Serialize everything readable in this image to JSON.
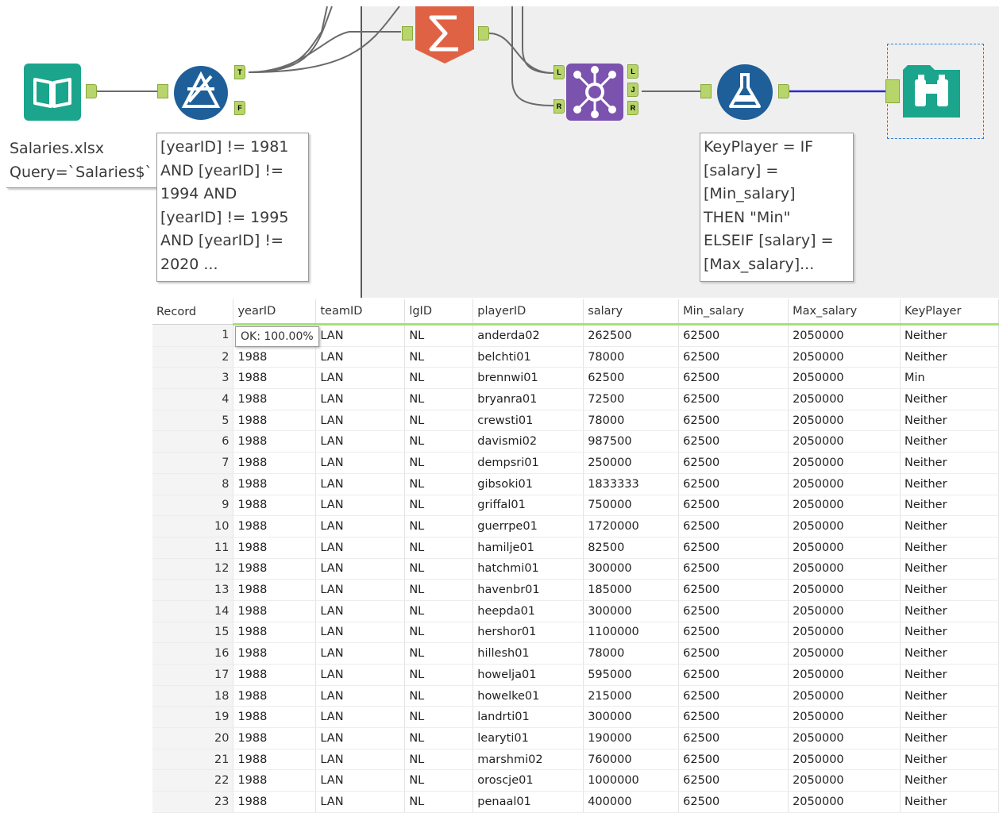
{
  "workflow": {
    "input_annotation": "Salaries.xlsx\nQuery=`Salaries$`",
    "filter_annotation": "[yearID] != 1981\nAND [yearID] !=\n1994 AND\n[yearID] != 1995\nAND [yearID] !=\n2020 ...",
    "formula_annotation": "KeyPlayer = IF\n[salary] =\n[Min_salary]\nTHEN \"Min\"\nELSEIF [salary] =\n[Max_salary]...",
    "filter_true_anchor": "T",
    "filter_false_anchor": "F",
    "join_left_in": "L",
    "join_right_in": "R",
    "join_out_left": "L",
    "join_out_join": "J",
    "join_out_right": "R",
    "icons": [
      "input-book-icon",
      "filter-icon",
      "summarize-sigma-icon",
      "join-icon",
      "formula-flask-icon",
      "browse-binoculars-icon"
    ],
    "colors": {
      "input": "#1aa58c",
      "filter": "#1f5f99",
      "summarize": "#e06245",
      "join": "#7b52ae",
      "formula": "#1f5f99",
      "browse": "#1aa58c",
      "anchor": "#b7d56a",
      "selection": "#2f7fd8"
    }
  },
  "tooltip": "OK: 100.00%",
  "results": {
    "columns": [
      "Record",
      "yearID",
      "teamID",
      "lgID",
      "playerID",
      "salary",
      "Min_salary",
      "Max_salary",
      "KeyPlayer"
    ],
    "rows": [
      [
        "1",
        "1988",
        "LAN",
        "NL",
        "anderda02",
        "262500",
        "62500",
        "2050000",
        "Neither"
      ],
      [
        "2",
        "1988",
        "LAN",
        "NL",
        "belchti01",
        "78000",
        "62500",
        "2050000",
        "Neither"
      ],
      [
        "3",
        "1988",
        "LAN",
        "NL",
        "brennwi01",
        "62500",
        "62500",
        "2050000",
        "Min"
      ],
      [
        "4",
        "1988",
        "LAN",
        "NL",
        "bryanra01",
        "72500",
        "62500",
        "2050000",
        "Neither"
      ],
      [
        "5",
        "1988",
        "LAN",
        "NL",
        "crewsti01",
        "78000",
        "62500",
        "2050000",
        "Neither"
      ],
      [
        "6",
        "1988",
        "LAN",
        "NL",
        "davismi02",
        "987500",
        "62500",
        "2050000",
        "Neither"
      ],
      [
        "7",
        "1988",
        "LAN",
        "NL",
        "dempsri01",
        "250000",
        "62500",
        "2050000",
        "Neither"
      ],
      [
        "8",
        "1988",
        "LAN",
        "NL",
        "gibsoki01",
        "1833333",
        "62500",
        "2050000",
        "Neither"
      ],
      [
        "9",
        "1988",
        "LAN",
        "NL",
        "griffal01",
        "750000",
        "62500",
        "2050000",
        "Neither"
      ],
      [
        "10",
        "1988",
        "LAN",
        "NL",
        "guerrpe01",
        "1720000",
        "62500",
        "2050000",
        "Neither"
      ],
      [
        "11",
        "1988",
        "LAN",
        "NL",
        "hamilje01",
        "82500",
        "62500",
        "2050000",
        "Neither"
      ],
      [
        "12",
        "1988",
        "LAN",
        "NL",
        "hatchmi01",
        "300000",
        "62500",
        "2050000",
        "Neither"
      ],
      [
        "13",
        "1988",
        "LAN",
        "NL",
        "havenbr01",
        "185000",
        "62500",
        "2050000",
        "Neither"
      ],
      [
        "14",
        "1988",
        "LAN",
        "NL",
        "heepda01",
        "300000",
        "62500",
        "2050000",
        "Neither"
      ],
      [
        "15",
        "1988",
        "LAN",
        "NL",
        "hershor01",
        "1100000",
        "62500",
        "2050000",
        "Neither"
      ],
      [
        "16",
        "1988",
        "LAN",
        "NL",
        "hillesh01",
        "78000",
        "62500",
        "2050000",
        "Neither"
      ],
      [
        "17",
        "1988",
        "LAN",
        "NL",
        "howelja01",
        "595000",
        "62500",
        "2050000",
        "Neither"
      ],
      [
        "18",
        "1988",
        "LAN",
        "NL",
        "howelke01",
        "215000",
        "62500",
        "2050000",
        "Neither"
      ],
      [
        "19",
        "1988",
        "LAN",
        "NL",
        "landrti01",
        "300000",
        "62500",
        "2050000",
        "Neither"
      ],
      [
        "20",
        "1988",
        "LAN",
        "NL",
        "learyti01",
        "190000",
        "62500",
        "2050000",
        "Neither"
      ],
      [
        "21",
        "1988",
        "LAN",
        "NL",
        "marshmi02",
        "760000",
        "62500",
        "2050000",
        "Neither"
      ],
      [
        "22",
        "1988",
        "LAN",
        "NL",
        "oroscje01",
        "1000000",
        "62500",
        "2050000",
        "Neither"
      ],
      [
        "23",
        "1988",
        "LAN",
        "NL",
        "penaal01",
        "400000",
        "62500",
        "2050000",
        "Neither"
      ]
    ]
  }
}
